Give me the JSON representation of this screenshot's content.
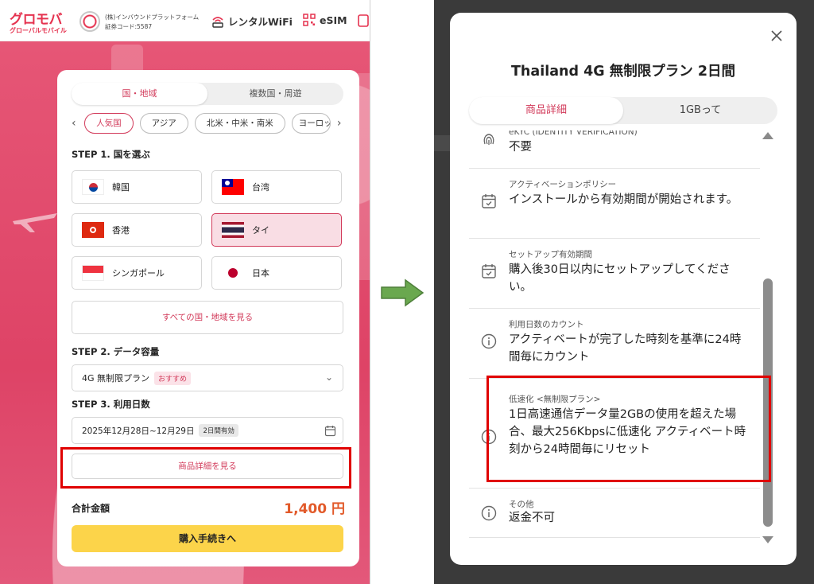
{
  "left": {
    "header": {
      "logo_main": "グロモバ",
      "logo_sub": "グローバルモバイル",
      "company_name": "(株)インバウンドプラットフォーム",
      "securities_code": "証券コード:5587",
      "rental_wifi": "レンタルWiFi",
      "esim": "eSIM"
    },
    "tabs": {
      "single": "国・地域",
      "multi": "複数国・周遊"
    },
    "regions": [
      "人気国",
      "アジア",
      "北米・中米・南米",
      "ヨーロッパ"
    ],
    "step1": "STEP 1. 国を選ぶ",
    "countries": [
      {
        "name": "韓国"
      },
      {
        "name": "台湾"
      },
      {
        "name": "香港"
      },
      {
        "name": "タイ"
      },
      {
        "name": "シンガポール"
      },
      {
        "name": "日本"
      }
    ],
    "all_countries": "すべての国・地域を見る",
    "step2": "STEP 2. データ容量",
    "plan": {
      "value": "4G 無制限プラン",
      "badge": "おすすめ"
    },
    "step3": "STEP 3. 利用日数",
    "date": {
      "value": "2025年12月28日~12月29日",
      "badge": "2日間有効"
    },
    "detail_button": "商品詳細を見る",
    "total_label": "合計金額",
    "total_value": "1,400 円",
    "buy_button": "購入手続きへ"
  },
  "modal": {
    "title": "Thailand 4G 無制限プラン 2日間",
    "tabs": {
      "details": "商品詳細",
      "about": "1GBって"
    },
    "rows": [
      {
        "icon": "fingerprint-icon",
        "label": "eKYC (IDENTITY VERIFICATION)",
        "text": "不要"
      },
      {
        "icon": "calendar-icon",
        "label": "アクティベーションポリシー",
        "text": "インストールから有効期間が開始されます。"
      },
      {
        "icon": "calendar-icon",
        "label": "セットアップ有効期間",
        "text": "購入後30日以内にセットアップしてください。"
      },
      {
        "icon": "info-icon",
        "label": "利用日数のカウント",
        "text": "アクティベートが完了した時刻を基準に24時間毎にカウント"
      },
      {
        "icon": "info-icon",
        "label": "低速化 <無制限プラン>",
        "text": "1日高速通信データ量2GBの使用を超えた場合、最大256Kbpsに低速化 アクティベート時刻から24時間毎にリセット"
      },
      {
        "icon": "info-icon",
        "label": "その他",
        "text": "返金不可"
      }
    ]
  },
  "colors": {
    "brand": "#e5324f",
    "accent": "#d23a5a",
    "buy": "#fcd44a",
    "price": "#e25a2a",
    "highlight": "#e00000",
    "arrow": "#6aa84f"
  }
}
